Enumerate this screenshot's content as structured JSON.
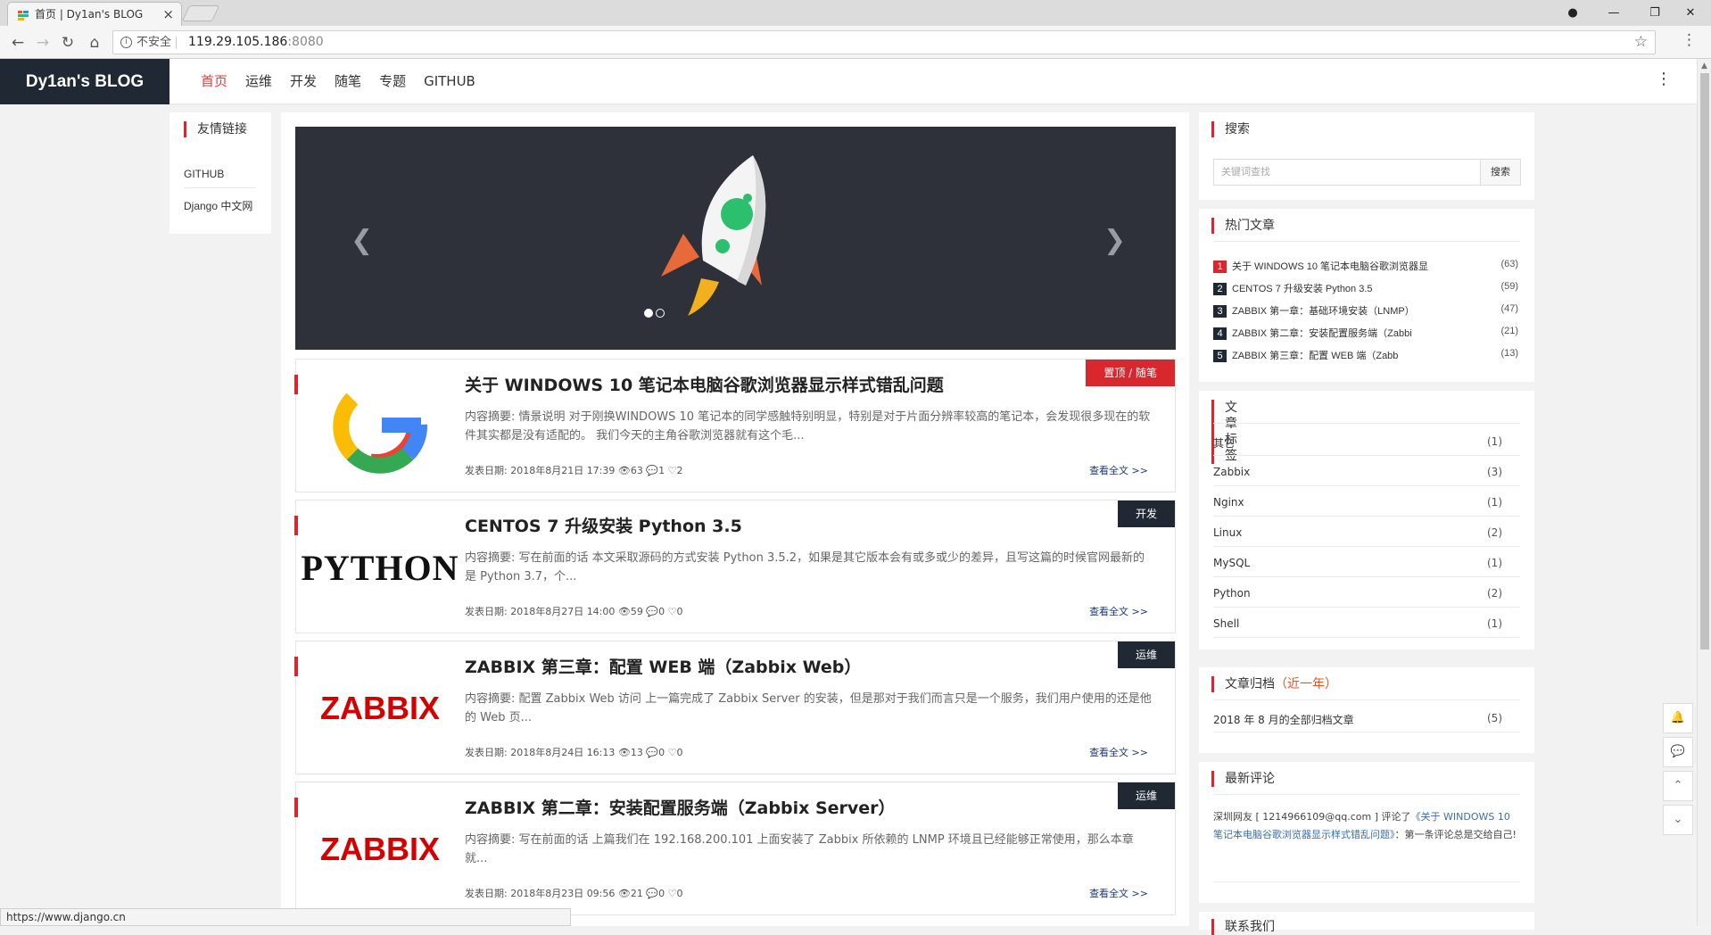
{
  "browser": {
    "tab_title": "首页 | Dy1an's BLOG",
    "security_label": "不安全",
    "url_host": "119.29.105.186",
    "url_port": ":8080",
    "status_url": "https://www.django.cn"
  },
  "site": {
    "logo": "Dy1an's BLOG",
    "nav": [
      "首页",
      "运维",
      "开发",
      "随笔",
      "专题",
      "GITHUB"
    ]
  },
  "friend_links": {
    "title": "友情链接",
    "items": [
      "GITHUB",
      "Django 中文网"
    ]
  },
  "articles": [
    {
      "title": "关于 WINDOWS 10 笔记本电脑谷歌浏览器显示样式错乱问题",
      "summary": "内容摘要: 情景说明 对于刚换WINDOWS 10 笔记本的同学感触特别明显，特别是对于片面分辨率较高的笔记本，会发现很多现在的软件其实都是没有适配的。 我们今天的主角谷歌浏览器就有这个毛...",
      "date": "发表日期: 2018年8月21日 17:39",
      "views": "63",
      "comments": "1",
      "likes": "2",
      "more": "查看全文 >>",
      "tag": "置顶 / 随笔",
      "tag_color": "#d9272e"
    },
    {
      "title": "CENTOS 7 升级安装 Python 3.5",
      "summary": "内容摘要: 写在前面的话 本文采取源码的方式安装 Python 3.5.2，如果是其它版本会有或多或少的差异，且写这篇的时候官网最新的是 Python 3.7，个...",
      "date": "发表日期: 2018年8月27日 14:00",
      "views": "59",
      "comments": "0",
      "likes": "0",
      "more": "查看全文 >>",
      "tag": "开发",
      "tag_color": "#1f2833"
    },
    {
      "title": "ZABBIX 第三章：配置 WEB 端（Zabbix Web）",
      "summary": "内容摘要: 配置 Zabbix Web 访问 上一篇完成了 Zabbix Server 的安装，但是那对于我们而言只是一个服务，我们用户使用的还是他的 Web 页...",
      "date": "发表日期: 2018年8月24日 16:13",
      "views": "13",
      "comments": "0",
      "likes": "0",
      "more": "查看全文 >>",
      "tag": "运维",
      "tag_color": "#1f2833"
    },
    {
      "title": "ZABBIX 第二章：安装配置服务端（Zabbix Server）",
      "summary": "内容摘要: 写在前面的话 上篇我们在 192.168.200.101 上面安装了 Zabbix 所依赖的 LNMP 环境且已经能够正常使用，那么本章就...",
      "date": "发表日期: 2018年8月23日 09:56",
      "views": "21",
      "comments": "0",
      "likes": "0",
      "more": "查看全文 >>",
      "tag": "运维",
      "tag_color": "#1f2833"
    }
  ],
  "logos": {
    "zabbix": "ZABBIX",
    "python": "PYTHON"
  },
  "search": {
    "title": "搜索",
    "placeholder": "关键词查找",
    "button": "搜索"
  },
  "hot": {
    "title": "热门文章",
    "items": [
      {
        "rank": "1",
        "title": "关于 WINDOWS 10 笔记本电脑谷歌浏览器显",
        "count": "(63)"
      },
      {
        "rank": "2",
        "title": "CENTOS 7 升级安装 Python 3.5",
        "count": "(59)"
      },
      {
        "rank": "3",
        "title": "ZABBIX 第一章：基础环境安装（LNMP）",
        "count": "(47)"
      },
      {
        "rank": "4",
        "title": "ZABBIX 第二章：安装配置服务端（Zabbi",
        "count": "(21)"
      },
      {
        "rank": "5",
        "title": "ZABBIX 第三章：配置 WEB 端（Zabb",
        "count": "(13)"
      }
    ],
    "rank1_color": "#d9272e"
  },
  "tags": {
    "title": "文章标签",
    "items": [
      {
        "name": "其它",
        "count": "(1)"
      },
      {
        "name": "Zabbix",
        "count": "(3)"
      },
      {
        "name": "Nginx",
        "count": "(1)"
      },
      {
        "name": "Linux",
        "count": "(2)"
      },
      {
        "name": "MySQL",
        "count": "(1)"
      },
      {
        "name": "Python",
        "count": "(2)"
      },
      {
        "name": "Shell",
        "count": "(1)"
      }
    ]
  },
  "archive": {
    "title": "文章归档",
    "subtitle": "（近一年）",
    "item": "2018 年 8 月的全部归档文章",
    "count": "(5)"
  },
  "comments": {
    "title": "最新评论",
    "author": "深圳网友 [ 1214966109@qq.com ] 评论了",
    "link": "《关于 WINDOWS 10 笔记本电脑谷歌浏览器显示样式错乱问题》",
    "text": "：第一条评论总是交给自己!"
  },
  "contact": {
    "title": "联系我们"
  },
  "colors": {
    "accent": "#d9272e",
    "dark": "#1f2833"
  }
}
